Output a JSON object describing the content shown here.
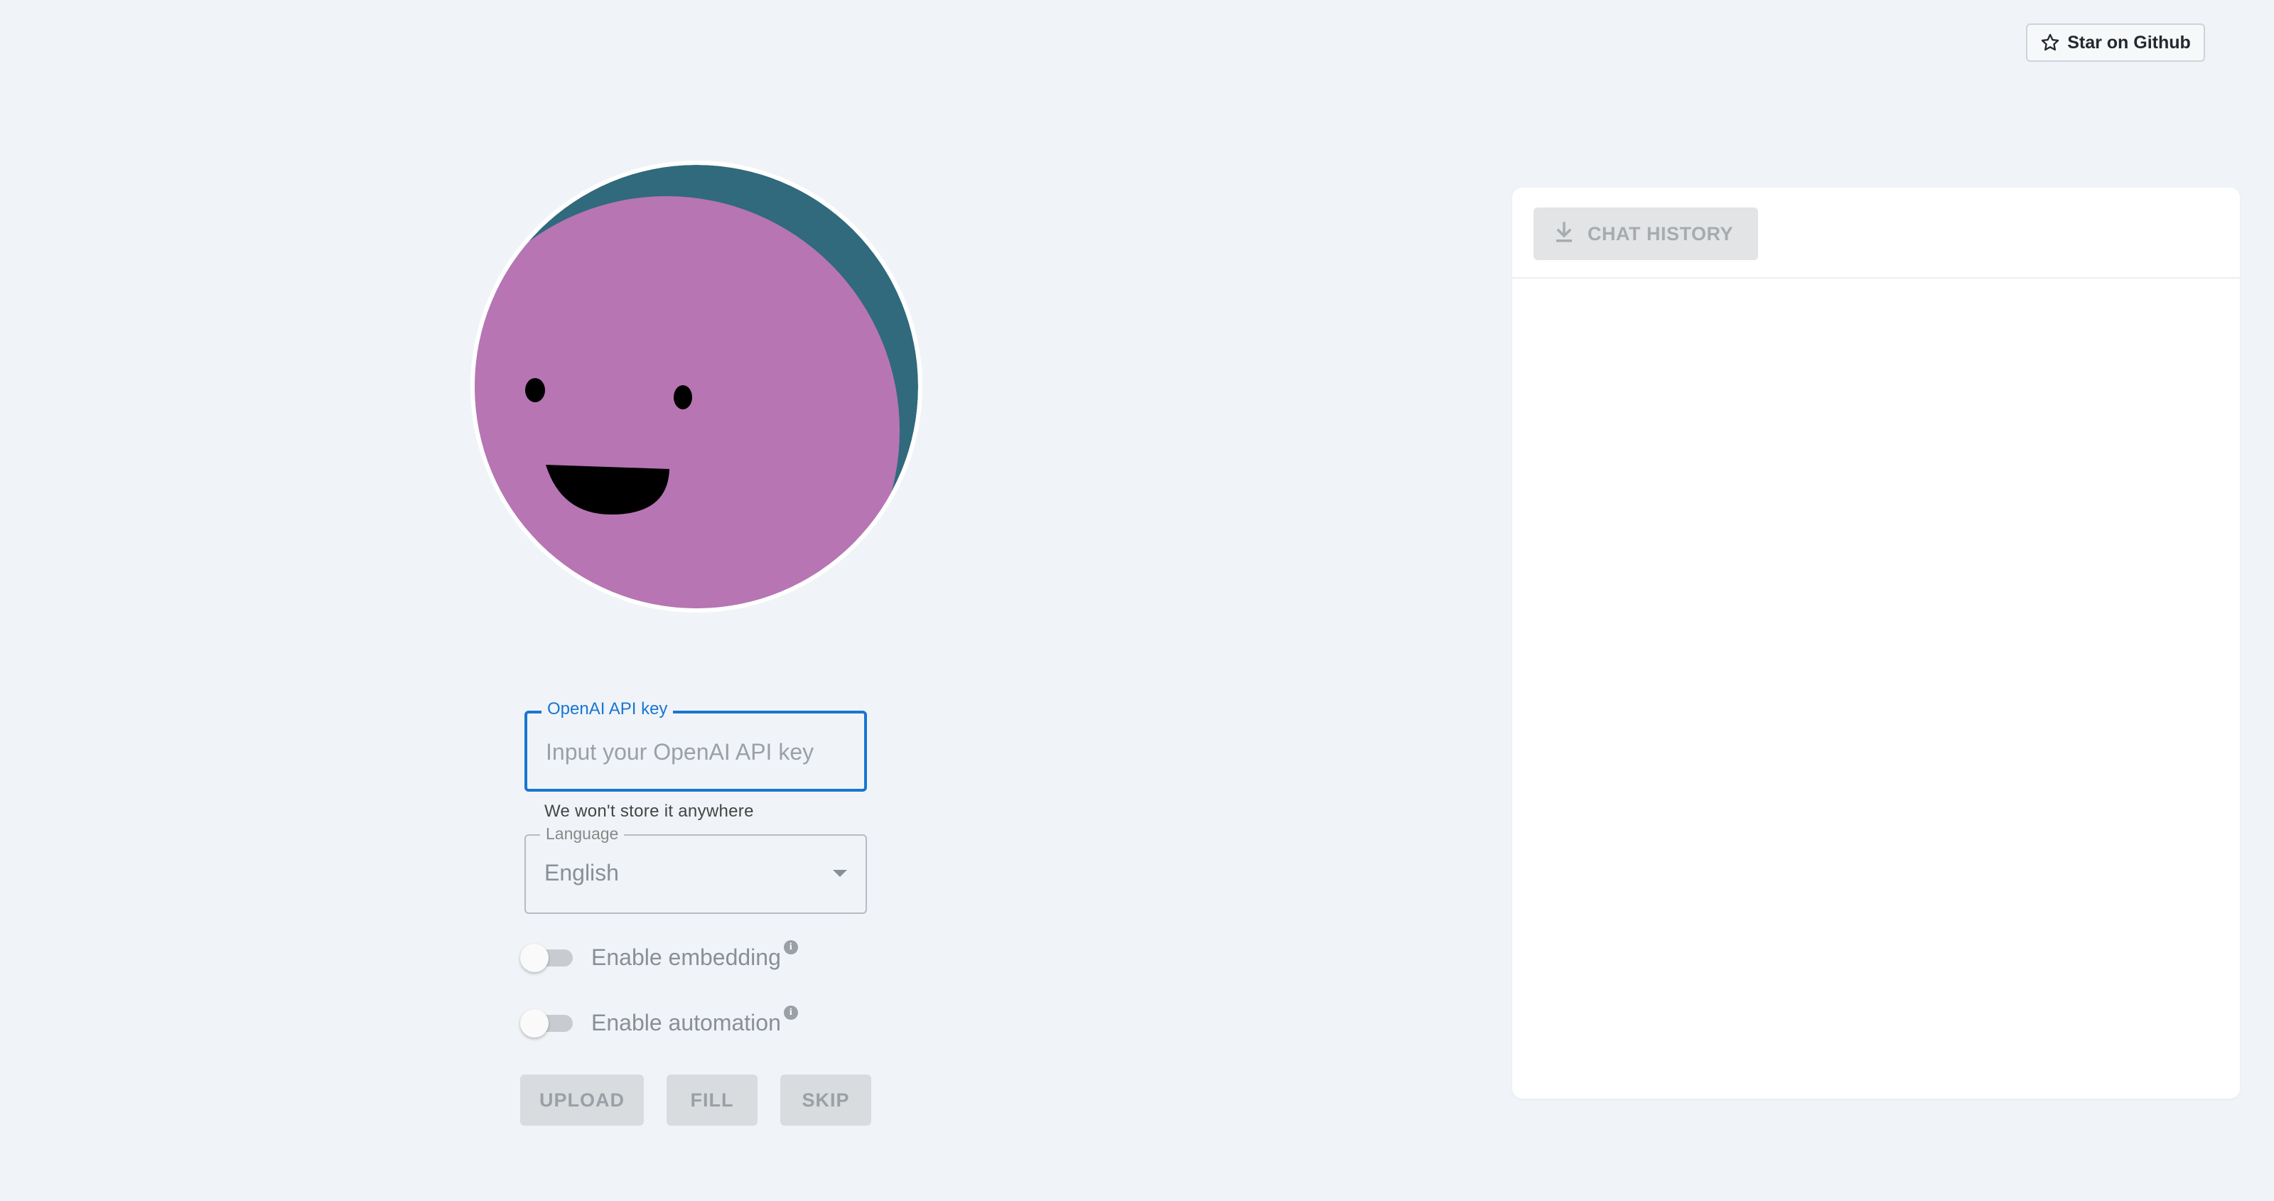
{
  "header": {
    "github_button_label": "Star on Github",
    "github_icon": "star-icon"
  },
  "avatar": {
    "face_color": "#b775b3",
    "hair_color": "#306a7c"
  },
  "form": {
    "api_key": {
      "label": "OpenAI API key",
      "placeholder": "Input your OpenAI API key",
      "value": "",
      "helper": "We won't store it anywhere"
    },
    "language": {
      "label": "Language",
      "selected": "English"
    },
    "toggles": [
      {
        "label": "Enable embedding",
        "checked": false,
        "info_icon": "info-icon"
      },
      {
        "label": "Enable automation",
        "checked": false,
        "info_icon": "info-icon"
      }
    ],
    "buttons": {
      "upload": "UPLOAD",
      "fill": "FILL",
      "skip": "SKIP"
    }
  },
  "chat_panel": {
    "history_button_label": "CHAT HISTORY",
    "history_icon": "download-icon",
    "messages": []
  },
  "colors": {
    "accent": "#1976d2",
    "background": "#f0f4f8",
    "disabled_button": "#d9dcdf"
  }
}
